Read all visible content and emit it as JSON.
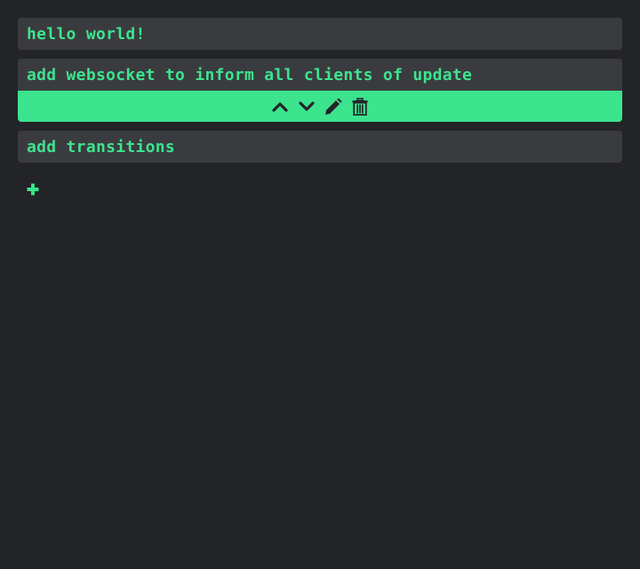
{
  "colors": {
    "background": "#232428",
    "card": "#3a3b3f",
    "accent": "#3ce48e",
    "icon_dark": "#232428"
  },
  "todos": [
    {
      "text": "hello world!"
    },
    {
      "text": "add websocket to inform all clients of update",
      "expanded": true
    },
    {
      "text": "add transitions"
    }
  ],
  "actions": {
    "icons": [
      "chevron-up-icon",
      "chevron-down-icon",
      "pencil-icon",
      "trash-icon"
    ]
  },
  "add": {
    "icon": "plus-icon"
  }
}
